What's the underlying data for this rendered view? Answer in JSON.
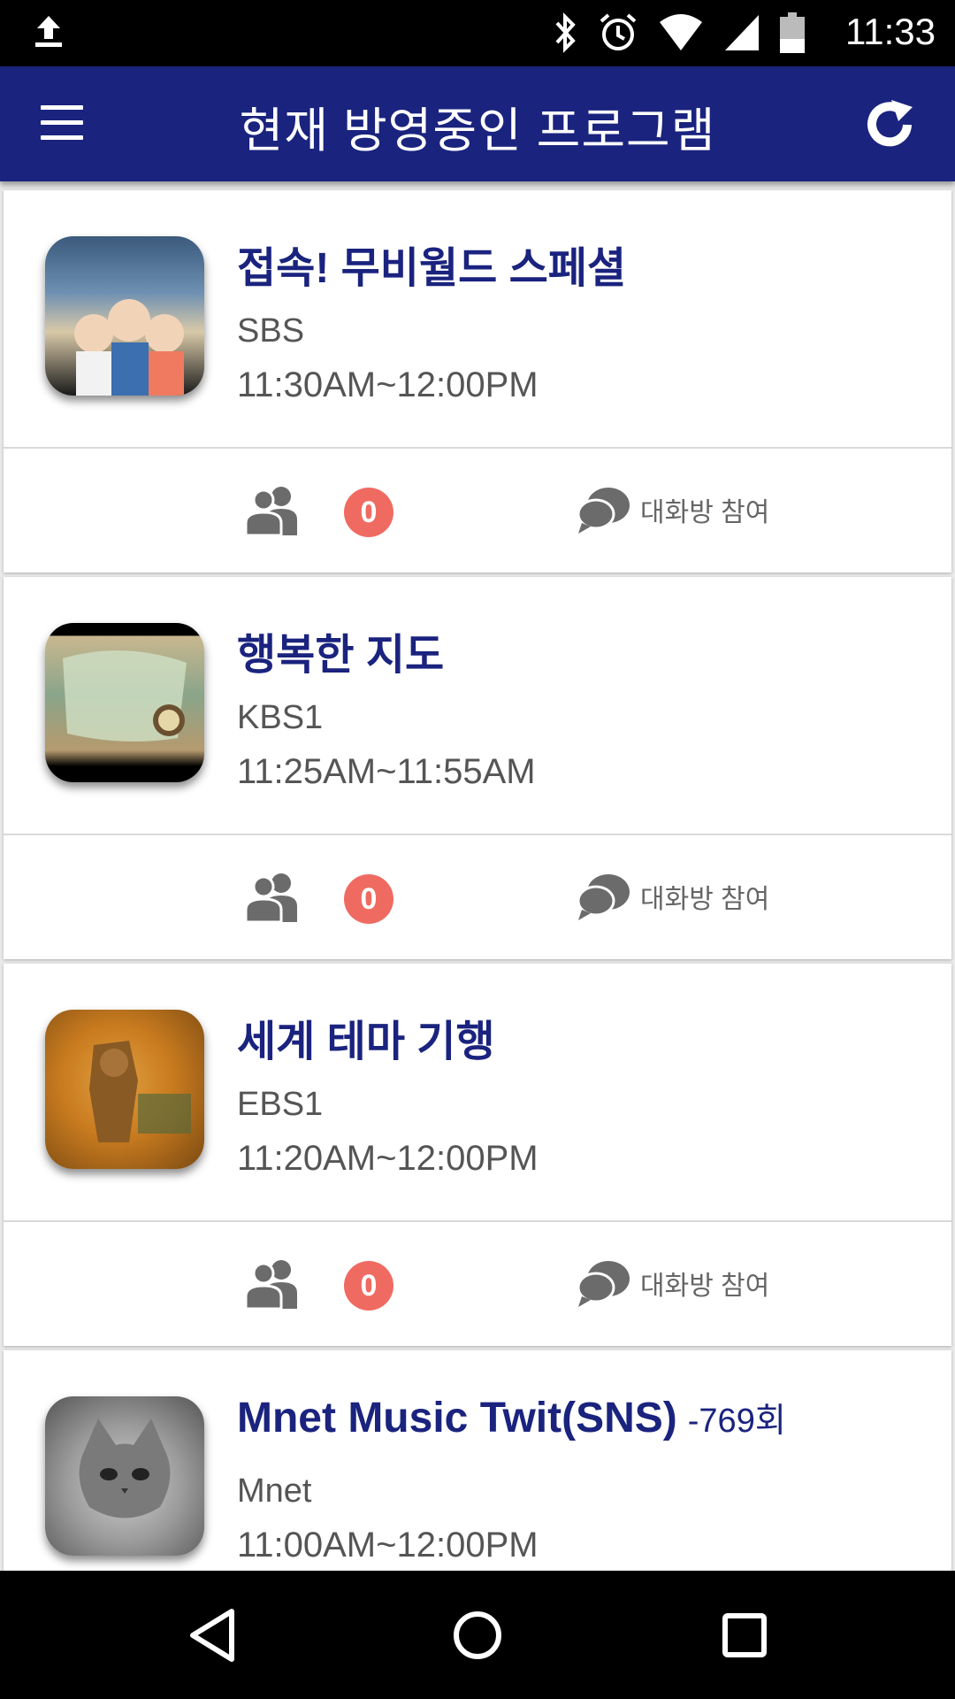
{
  "status_bar": {
    "time": "11:33",
    "icons": [
      "upload-icon",
      "bluetooth-icon",
      "alarm-icon",
      "wifi-icon",
      "signal-icon",
      "battery-icon"
    ]
  },
  "app_bar": {
    "title": "현재 방영중인 프로그램",
    "background": "#1a237e"
  },
  "programs": [
    {
      "title": "접속! 무비월드 스페셜",
      "episode": "",
      "channel": "SBS",
      "time": "11:30AM~12:00PM",
      "participants": "0",
      "chat_label": "대화방 참여",
      "thumbnail": "movie-world-thumbnail",
      "thumb_colors": [
        "#3b5a7c",
        "#d8c9a8",
        "#1a1a1a"
      ]
    },
    {
      "title": "행복한 지도",
      "episode": "",
      "channel": "KBS1",
      "time": "11:25AM~11:55AM",
      "participants": "0",
      "chat_label": "대화방 참여",
      "thumbnail": "happy-map-thumbnail",
      "thumb_colors": [
        "#8aa58a",
        "#c9b78f",
        "#000000"
      ]
    },
    {
      "title": "세계 테마 기행",
      "episode": "",
      "channel": "EBS1",
      "time": "11:20AM~12:00PM",
      "participants": "0",
      "chat_label": "대화방 참여",
      "thumbnail": "world-theme-travel-thumbnail",
      "thumb_colors": [
        "#c97b1f",
        "#7a4a12",
        "#e0a040"
      ]
    },
    {
      "title": "Mnet Music Twit(SNS)",
      "episode": "-769회",
      "channel": "Mnet",
      "time": "11:00AM~12:00PM",
      "participants": "",
      "chat_label": "",
      "thumbnail": "kitten-thumbnail",
      "thumb_colors": [
        "#9a9a9a",
        "#555555",
        "#d0d0d0"
      ]
    }
  ],
  "colors": {
    "title_text": "#1a237e",
    "badge": "#ef6b61",
    "secondary_text": "#555555"
  },
  "nav_bar": {
    "buttons": [
      "back-icon",
      "home-icon",
      "recents-icon"
    ]
  }
}
